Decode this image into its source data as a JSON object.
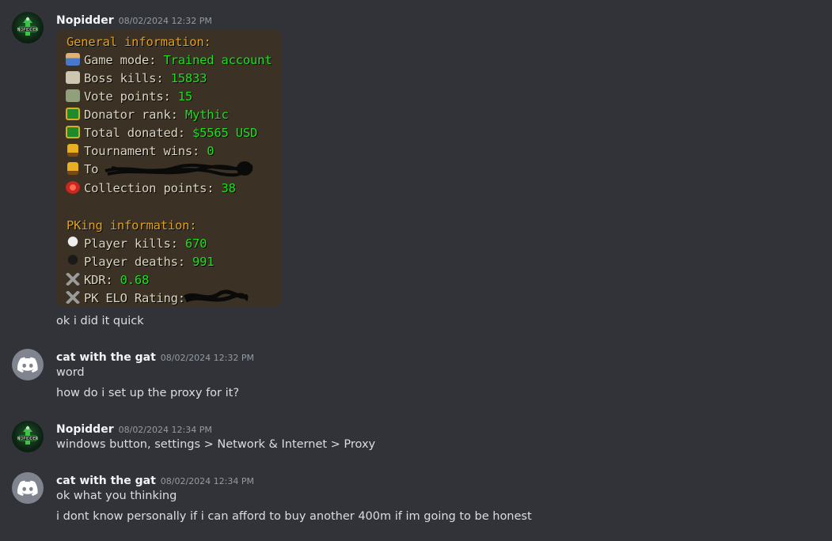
{
  "messages": [
    {
      "username": "Nopidder",
      "timestamp": "08/02/2024 12:32 PM",
      "avatar": "nopidder-avatar",
      "lines": [
        "ok i did it quick"
      ]
    },
    {
      "username": "cat with the gat",
      "timestamp": "08/02/2024 12:32 PM",
      "avatar": "discord-default-avatar",
      "lines": [
        "word",
        "how do i set up the proxy for it?"
      ]
    },
    {
      "username": "Nopidder",
      "timestamp": "08/02/2024 12:34 PM",
      "avatar": "nopidder-avatar",
      "lines": [
        "windows button, settings > Network & Internet > Proxy"
      ]
    },
    {
      "username": "cat with the gat",
      "timestamp": "08/02/2024 12:34 PM",
      "avatar": "discord-default-avatar",
      "lines": [
        "ok what you thinking",
        "i dont know personally if i can afford to buy another 400m if im going to be honest"
      ]
    }
  ],
  "game_stats": {
    "general_heading": "General information:",
    "rows": [
      {
        "label": "Game mode:",
        "value": "Trained account",
        "icon": "game-mode-icon"
      },
      {
        "label": "Boss kills:",
        "value": "15833",
        "icon": "boss-kills-icon"
      },
      {
        "label": "Vote points:",
        "value": "15",
        "icon": "vote-points-icon"
      },
      {
        "label": "Donator rank:",
        "value": "Mythic",
        "icon": "donator-rank-icon"
      },
      {
        "label": "Total donated:",
        "value": "$5565 USD",
        "icon": "total-donated-icon"
      },
      {
        "label": "Tournament wins:",
        "value": "0",
        "icon": "trophy-icon"
      },
      {
        "label": "To",
        "value": "",
        "icon": "trophy-icon"
      },
      {
        "label": "Collection points:",
        "value": "38",
        "icon": "collection-icon"
      }
    ],
    "pk_heading": "PKing information:",
    "pk_rows": [
      {
        "label": "Player kills:",
        "value": "670",
        "icon": "skull-icon"
      },
      {
        "label": "Player deaths:",
        "value": "991",
        "icon": "dark-skull-icon"
      },
      {
        "label": "KDR:",
        "value": "0.68",
        "icon": "crossed-swords-icon"
      },
      {
        "label": "PK ELO Rating:",
        "value": "",
        "icon": "crossed-swords-icon"
      }
    ]
  },
  "colors": {
    "background": "#313338",
    "username": "#f2f3f5",
    "timestamp": "#949ba4",
    "text": "#dbdee1",
    "game_heading": "#e0a220",
    "game_value": "#19e41a"
  }
}
